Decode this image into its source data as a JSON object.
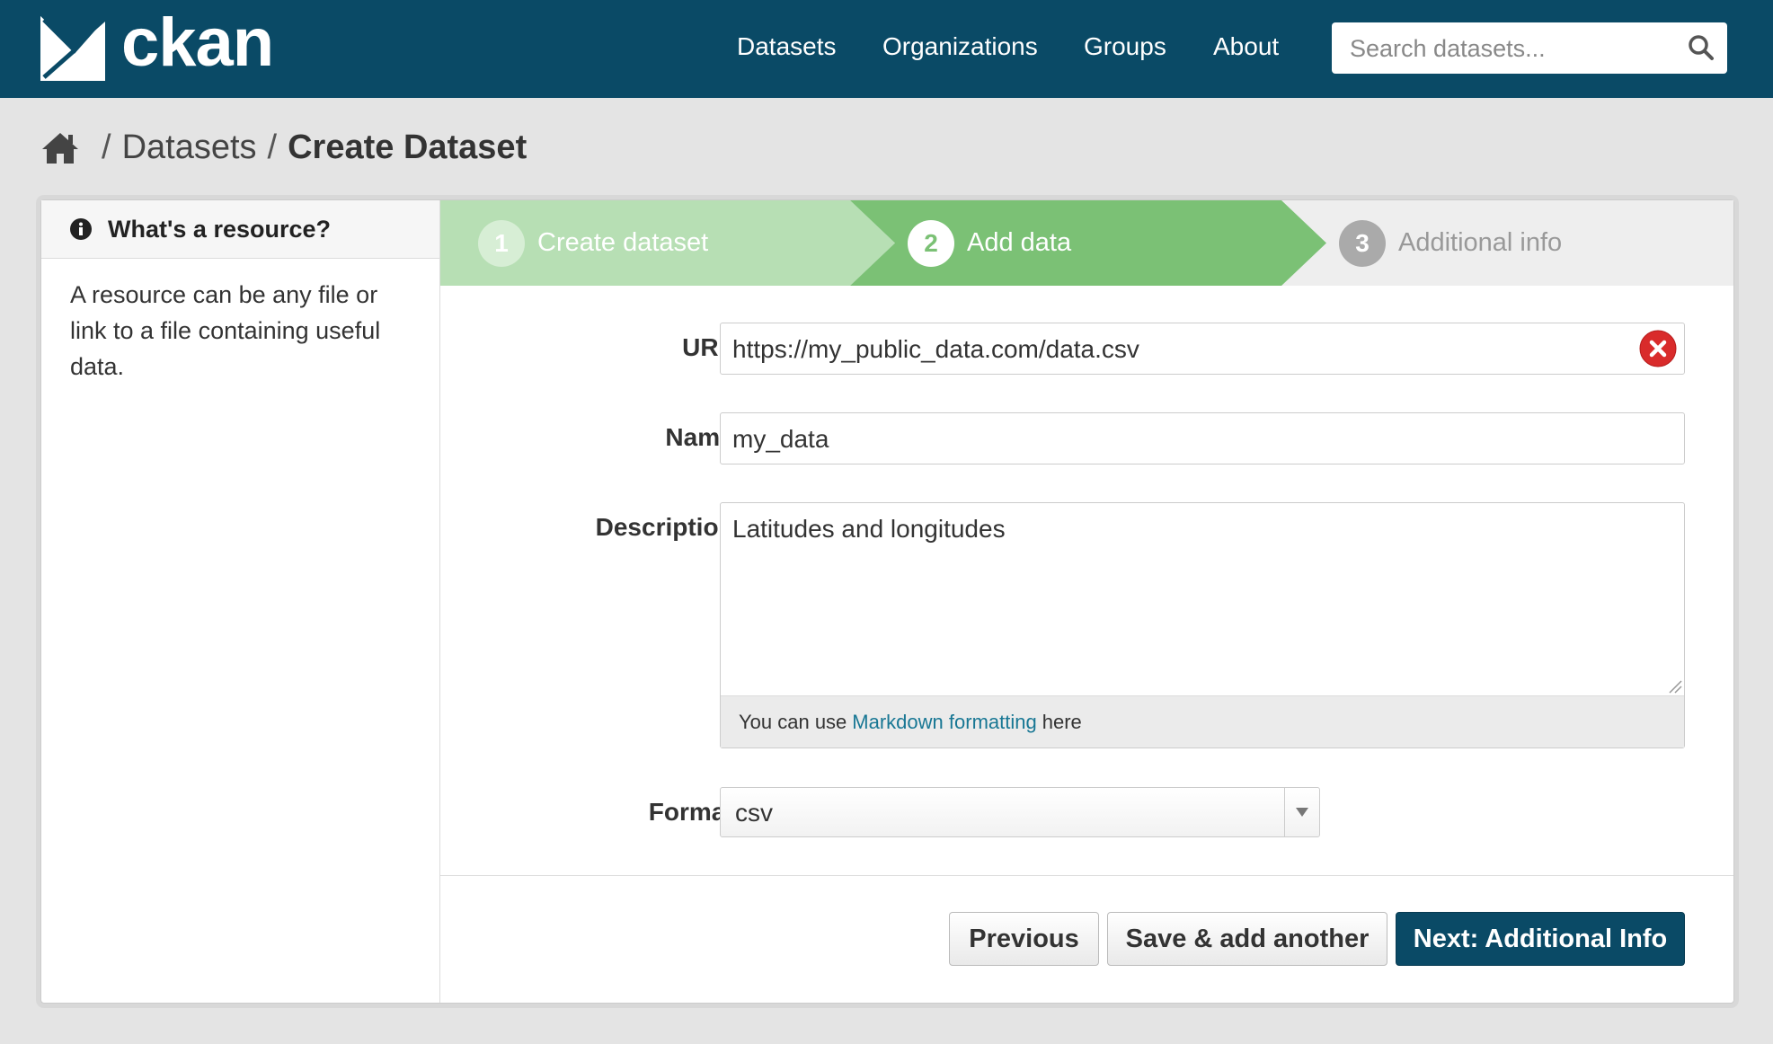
{
  "header": {
    "logo_text": "ckan",
    "nav": [
      "Datasets",
      "Organizations",
      "Groups",
      "About"
    ],
    "search_placeholder": "Search datasets..."
  },
  "breadcrumb": {
    "items": [
      "Datasets",
      "Create Dataset"
    ]
  },
  "sidebar": {
    "title": "What's a resource?",
    "body": "A resource can be any file or link to a file containing useful data."
  },
  "stages": [
    {
      "number": "1",
      "label": "Create dataset",
      "state": "complete"
    },
    {
      "number": "2",
      "label": "Add data",
      "state": "active"
    },
    {
      "number": "3",
      "label": "Additional info",
      "state": "inactive"
    }
  ],
  "form": {
    "url_label": "URL:",
    "url_value": "https://my_public_data.com/data.csv",
    "name_label": "Name:",
    "name_value": "my_data",
    "description_label": "Description:",
    "description_value": "Latitudes and longitudes",
    "markdown_prefix": "You can use",
    "markdown_link": "Markdown formatting",
    "markdown_suffix": "here",
    "format_label": "Format:",
    "format_value": "csv"
  },
  "buttons": {
    "previous": "Previous",
    "save_add": "Save & add another",
    "next": "Next: Additional Info"
  },
  "colors": {
    "masthead": "#0a4a66",
    "stage_complete": "#b7dfb4",
    "stage_active": "#7bc175",
    "stage_inactive": "#eeeeee",
    "link": "#187794",
    "clear_icon": "#d92b2b"
  }
}
